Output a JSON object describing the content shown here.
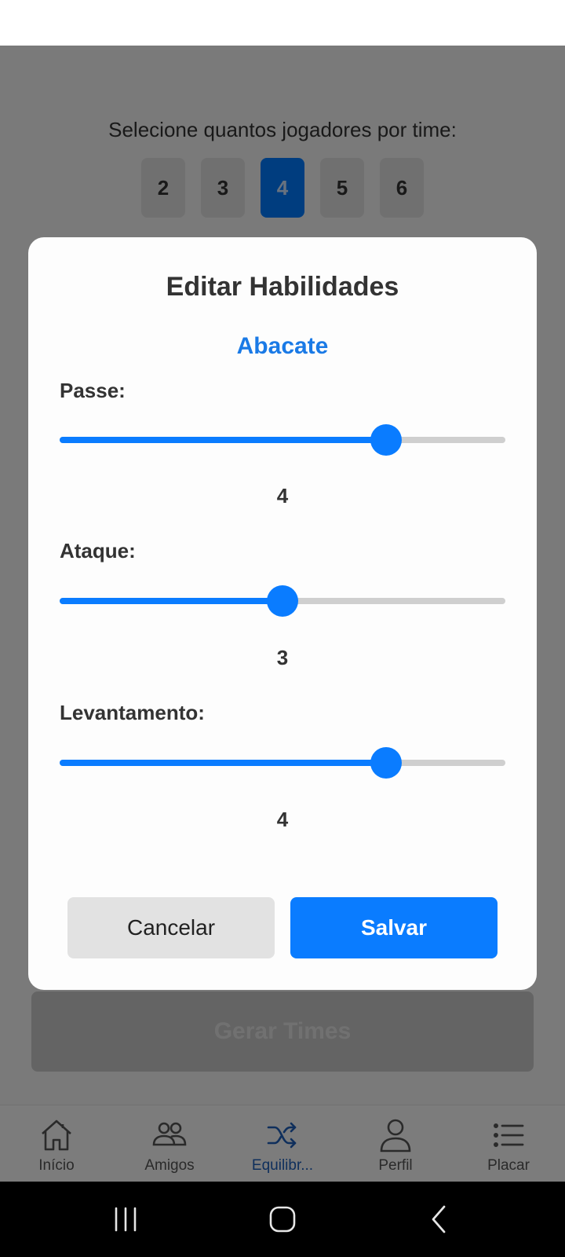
{
  "screen": {
    "prompt": "Selecione quantos jogadores por time:",
    "team_sizes": [
      "2",
      "3",
      "4",
      "5",
      "6"
    ],
    "selected_team_size": "4",
    "generate_label": "Gerar Times"
  },
  "modal": {
    "title": "Editar Habilidades",
    "player_name": "Abacate",
    "skills": [
      {
        "label": "Passe:",
        "value": "4",
        "level": 4
      },
      {
        "label": "Ataque:",
        "value": "3",
        "level": 3
      },
      {
        "label": "Levantamento:",
        "value": "4",
        "level": 4
      }
    ],
    "slider_range": [
      1,
      5
    ],
    "cancel_label": "Cancelar",
    "save_label": "Salvar"
  },
  "tabs": [
    {
      "label": "Início",
      "icon": "home-icon"
    },
    {
      "label": "Amigos",
      "icon": "friends-icon"
    },
    {
      "label": "Equilibr...",
      "icon": "shuffle-icon",
      "active": true
    },
    {
      "label": "Perfil",
      "icon": "user-icon"
    },
    {
      "label": "Placar",
      "icon": "list-icon"
    }
  ],
  "colors": {
    "accent": "#0a7cff",
    "player_name": "#1a7ae6",
    "active_tab": "#1f5fb8"
  }
}
